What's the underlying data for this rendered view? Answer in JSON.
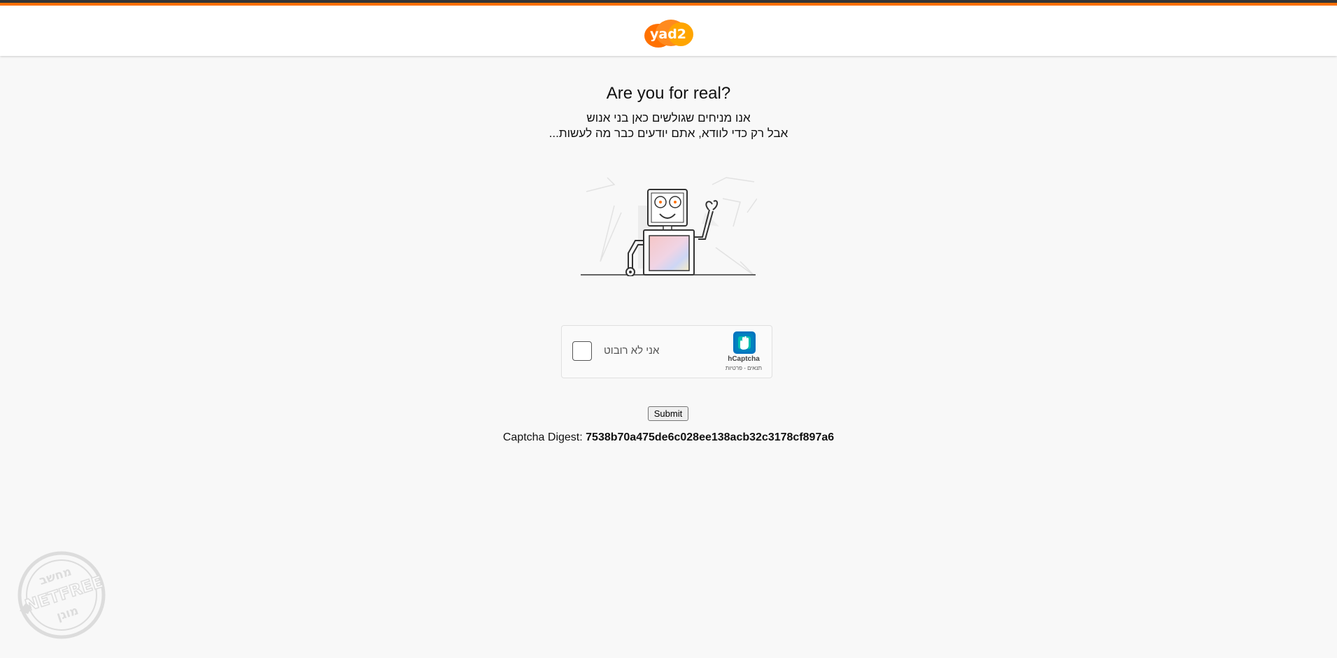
{
  "brand": {
    "logo_text": "yad2",
    "accent_color": "#ff7100",
    "topbar_dark_color": "#363636"
  },
  "page": {
    "title": "Are you for real?",
    "subtitle_line1": "אנו מניחים שגולשים כאן בני אנוש",
    "subtitle_line2": "אבל רק כדי לוודא, אתם יודעים כבר מה לעשות..."
  },
  "captcha": {
    "checkbox_label": "אני לא רובוט",
    "provider_name": "hCaptcha",
    "provider_links": "תנאים - פרטיות"
  },
  "form": {
    "submit_label": "Submit"
  },
  "digest": {
    "label": "Captcha Digest:",
    "value": "7538b70a475de6c028ee138acb32c3178cf897a6"
  },
  "watermark": {
    "top_text": "מחשב",
    "middle_text": "NETFREE",
    "bottom_text": "מוגן"
  }
}
